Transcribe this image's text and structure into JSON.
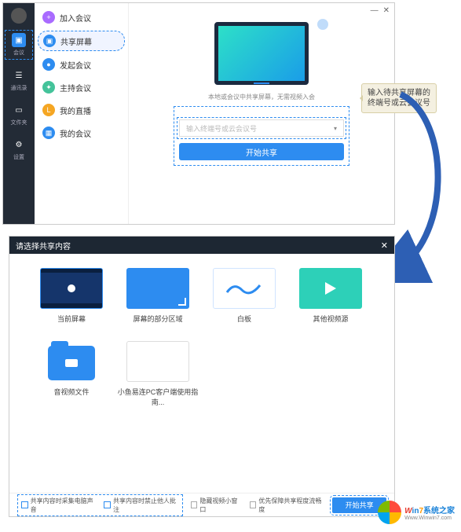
{
  "top_window": {
    "sidebar": {
      "items": [
        {
          "id": "meeting",
          "label": "会议",
          "active": true
        },
        {
          "id": "contacts",
          "label": "通讯录"
        },
        {
          "id": "files",
          "label": "文件夹"
        },
        {
          "id": "settings",
          "label": "设置"
        }
      ]
    },
    "menu": {
      "items": [
        {
          "id": "join",
          "label": "加入会议",
          "color": "c-purple",
          "icon": "+"
        },
        {
          "id": "share",
          "label": "共享屏幕",
          "color": "c-blue",
          "icon": "▣",
          "selected": true
        },
        {
          "id": "start",
          "label": "发起会议",
          "color": "c-blue",
          "icon": "●"
        },
        {
          "id": "host",
          "label": "主持会议",
          "color": "c-green",
          "icon": "✦"
        },
        {
          "id": "live",
          "label": "我的直播",
          "color": "c-orange",
          "icon": "L"
        },
        {
          "id": "my",
          "label": "我的会议",
          "color": "c-blue",
          "icon": "▦"
        }
      ]
    },
    "main": {
      "subtitle": "本地或会议中共享屏幕，无需视频入会",
      "input_placeholder": "输入终端号或云会议号",
      "start_button": "开始共享"
    },
    "tooltip": "输入待共享屏幕的终端号或云会议号",
    "window_controls": {
      "min": "—",
      "close": "✕"
    }
  },
  "dialog": {
    "title": "请选择共享内容",
    "close": "✕",
    "sources": [
      {
        "id": "screen",
        "label": "当前屏幕",
        "selected": true
      },
      {
        "id": "region",
        "label": "屏幕的部分区域"
      },
      {
        "id": "whiteboard",
        "label": "白板"
      },
      {
        "id": "video",
        "label": "其他视频源"
      },
      {
        "id": "folder",
        "label": "音视频文件"
      },
      {
        "id": "doc",
        "label": "小鱼易连PC客户端使用指南..."
      }
    ],
    "footer": {
      "checks": [
        {
          "id": "audio",
          "label": "共享内容时采集电脑声音",
          "blue": true
        },
        {
          "id": "mute",
          "label": "共享内容时禁止他人批注",
          "blue": true
        },
        {
          "id": "hide",
          "label": "隐藏视频小窗口",
          "blue": false
        },
        {
          "id": "smooth",
          "label": "优先保障共享程度流畅度",
          "blue": false
        }
      ],
      "start": "开始共享"
    }
  },
  "watermark": {
    "line1a": "W",
    "line1b": "in",
    "line1c": "7",
    "line1d": "系统之家",
    "line2": "Www.Winwin7.com"
  }
}
